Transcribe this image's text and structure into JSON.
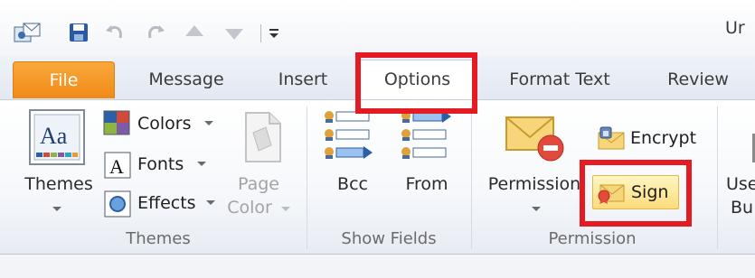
{
  "window": {
    "title_partial": "Ur"
  },
  "tabs": [
    "File",
    "Message",
    "Insert",
    "Options",
    "Format Text",
    "Review"
  ],
  "ribbon": {
    "themes_group": {
      "label": "Themes",
      "themes_button": "Themes",
      "colors": "Colors",
      "fonts": "Fonts",
      "effects": "Effects",
      "page_color_line1": "Page",
      "page_color_line2": "Color"
    },
    "show_fields_group": {
      "label": "Show Fields",
      "bcc": "Bcc",
      "from": "From"
    },
    "permission_group": {
      "label": "Permission",
      "permission_button": "Permission",
      "encrypt": "Encrypt",
      "sign": "Sign"
    },
    "partial_group": {
      "label_line1": "Use",
      "label_line2": "Bu"
    }
  },
  "colors": {
    "file_tab": "#f08a18",
    "highlight": "#e51b24",
    "sign_hover": "#fbdc7a"
  }
}
